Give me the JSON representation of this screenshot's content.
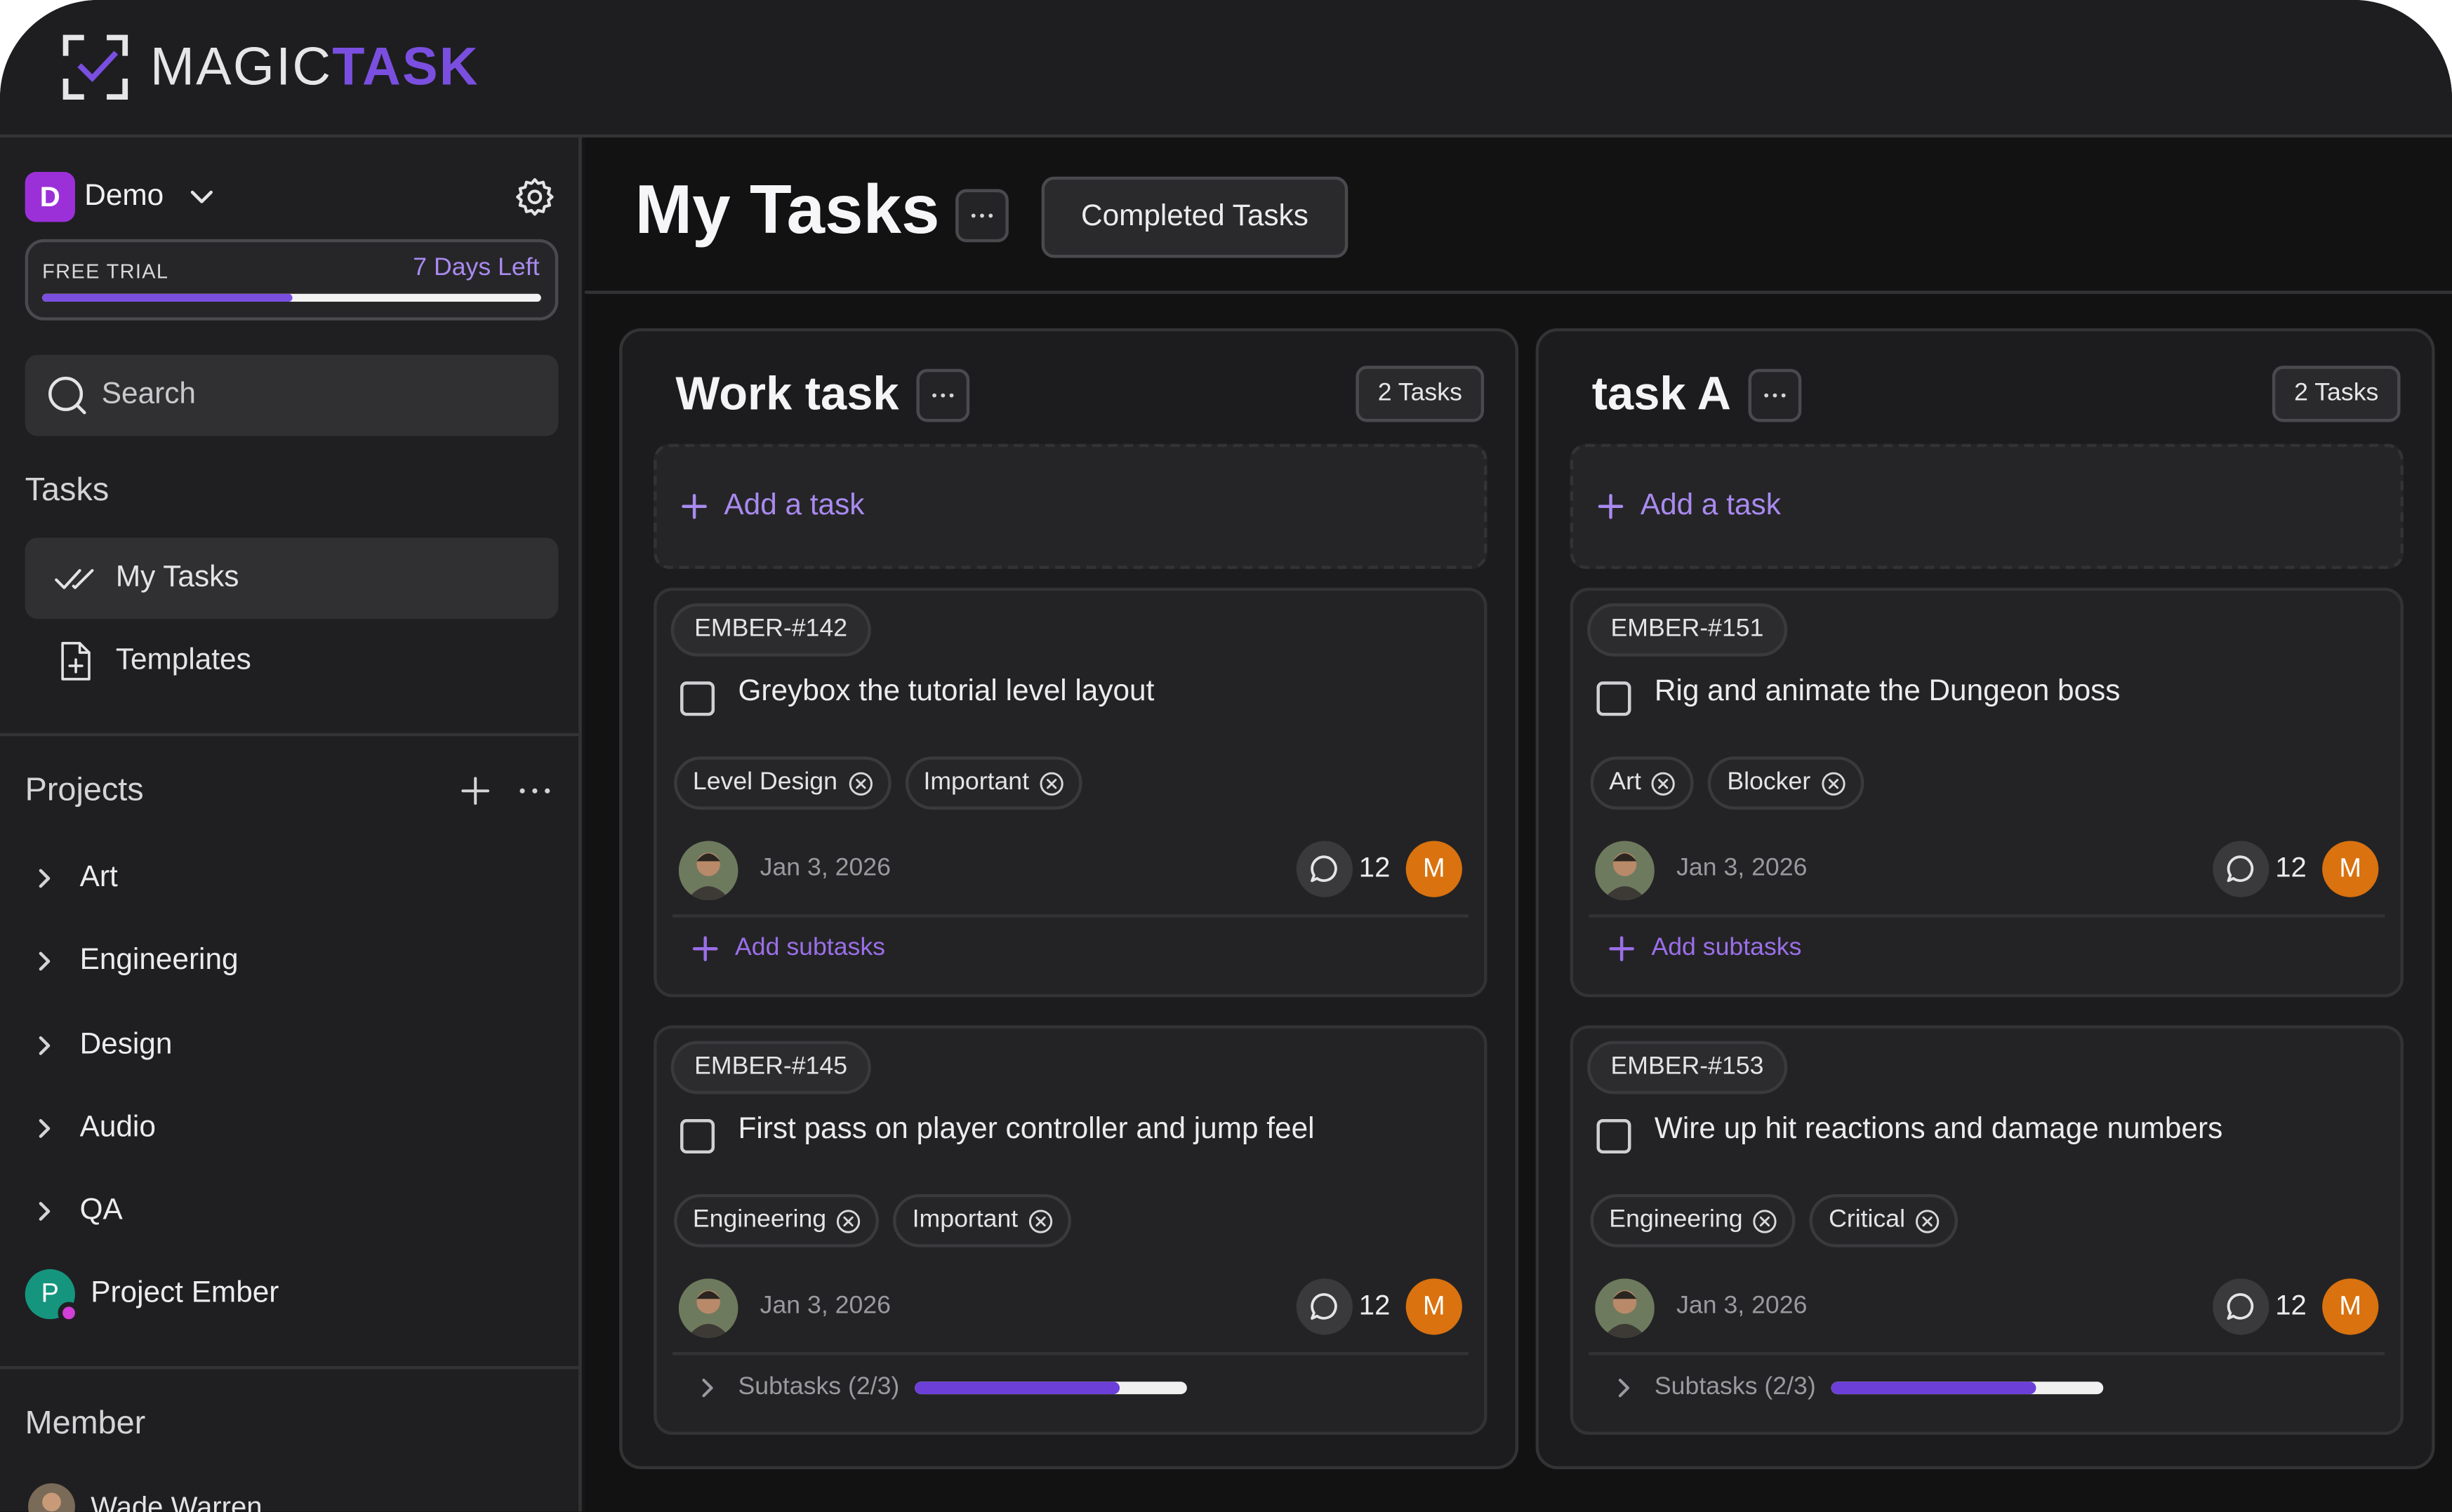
{
  "app": {
    "logo_magic": "MAGIC",
    "logo_task": "TASK",
    "accent": "#7a4fe0"
  },
  "sidebar": {
    "workspace": {
      "initial": "D",
      "name": "Demo"
    },
    "trial": {
      "label": "FREE TRIAL",
      "days_left": "7 Days Left",
      "progress": 0.5
    },
    "search": {
      "placeholder": "Search"
    },
    "tasks_section": "Tasks",
    "nav": [
      {
        "label": "My Tasks",
        "icon": "double-check-icon",
        "active": true
      },
      {
        "label": "Templates",
        "icon": "file-plus-icon",
        "active": false
      }
    ],
    "projects_section": "Projects",
    "projects": [
      "Art",
      "Engineering",
      "Design",
      "Audio",
      "QA"
    ],
    "project_ember": {
      "initial": "P",
      "name": "Project Ember"
    },
    "member_section": "Member",
    "member_name": "Wade Warren"
  },
  "main": {
    "title": "My Tasks",
    "completed_button": "Completed Tasks",
    "columns": [
      {
        "title": "Work task",
        "count": "2 Tasks",
        "add_task": "Add a task",
        "cards": [
          {
            "id": "EMBER-#142",
            "title": "Greybox the tutorial level layout",
            "tags": [
              "Level Design",
              "Important"
            ],
            "date": "Jan 3, 2026",
            "comments": "12",
            "owner": "M",
            "subtask_add": "Add subtasks"
          },
          {
            "id": "EMBER-#145",
            "title": "First pass on player controller and jump feel",
            "tags": [
              "Engineering",
              "Important"
            ],
            "date": "Jan 3, 2026",
            "comments": "12",
            "owner": "M",
            "subtasks_label": "Subtasks (2/3)",
            "subtasks_progress": 0.75
          }
        ]
      },
      {
        "title": "task A",
        "count": "2 Tasks",
        "add_task": "Add a task",
        "cards": [
          {
            "id": "EMBER-#151",
            "title": "Rig and animate the Dungeon boss",
            "tags": [
              "Art",
              "Blocker"
            ],
            "date": "Jan 3, 2026",
            "comments": "12",
            "owner": "M",
            "subtask_add": "Add subtasks"
          },
          {
            "id": "EMBER-#153",
            "title": "Wire up hit reactions and damage numbers",
            "tags": [
              "Engineering",
              "Critical"
            ],
            "date": "Jan 3, 2026",
            "comments": "12",
            "owner": "M",
            "subtasks_label": "Subtasks (2/3)",
            "subtasks_progress": 0.75
          }
        ]
      }
    ]
  }
}
